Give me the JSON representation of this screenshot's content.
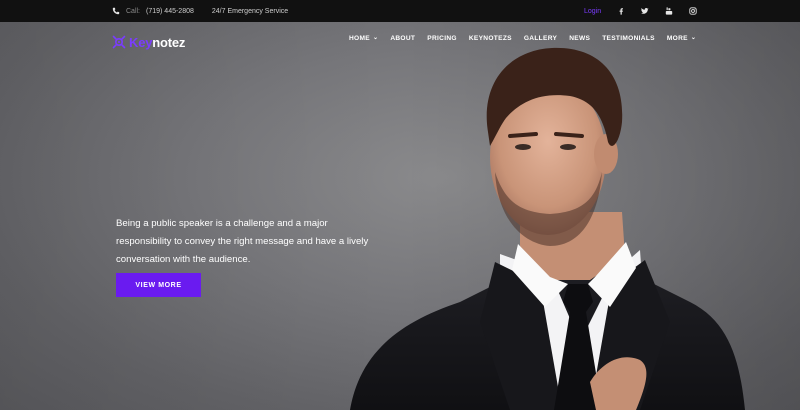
{
  "topbar": {
    "call_label": "Call:",
    "phone": "(719) 445-2808",
    "emergency": "24/7 Emergency Service",
    "login": "Login",
    "social_icons": [
      "facebook-icon",
      "twitter-icon",
      "youtube-icon",
      "instagram-icon"
    ]
  },
  "header": {
    "logo_accent": "Key",
    "logo_rest": "notez",
    "nav": [
      {
        "label": "HOME",
        "has_dropdown": true
      },
      {
        "label": "ABOUT",
        "has_dropdown": false
      },
      {
        "label": "PRICING",
        "has_dropdown": false
      },
      {
        "label": "KEYNOTEZS",
        "has_dropdown": false
      },
      {
        "label": "GALLERY",
        "has_dropdown": false
      },
      {
        "label": "NEWS",
        "has_dropdown": false
      },
      {
        "label": "TESTIMONIALS",
        "has_dropdown": false
      },
      {
        "label": "MORE",
        "has_dropdown": true
      }
    ]
  },
  "hero": {
    "line1": "Being a public speaker is a challenge and a major",
    "line2": "responsibility to convey the right message and have a lively",
    "line3": "conversation with the audience.",
    "cta_label": "VIEW MORE"
  },
  "colors": {
    "accent": "#7b3cff",
    "cta_bg": "#6a1bf0",
    "topbar_bg": "#111111"
  }
}
